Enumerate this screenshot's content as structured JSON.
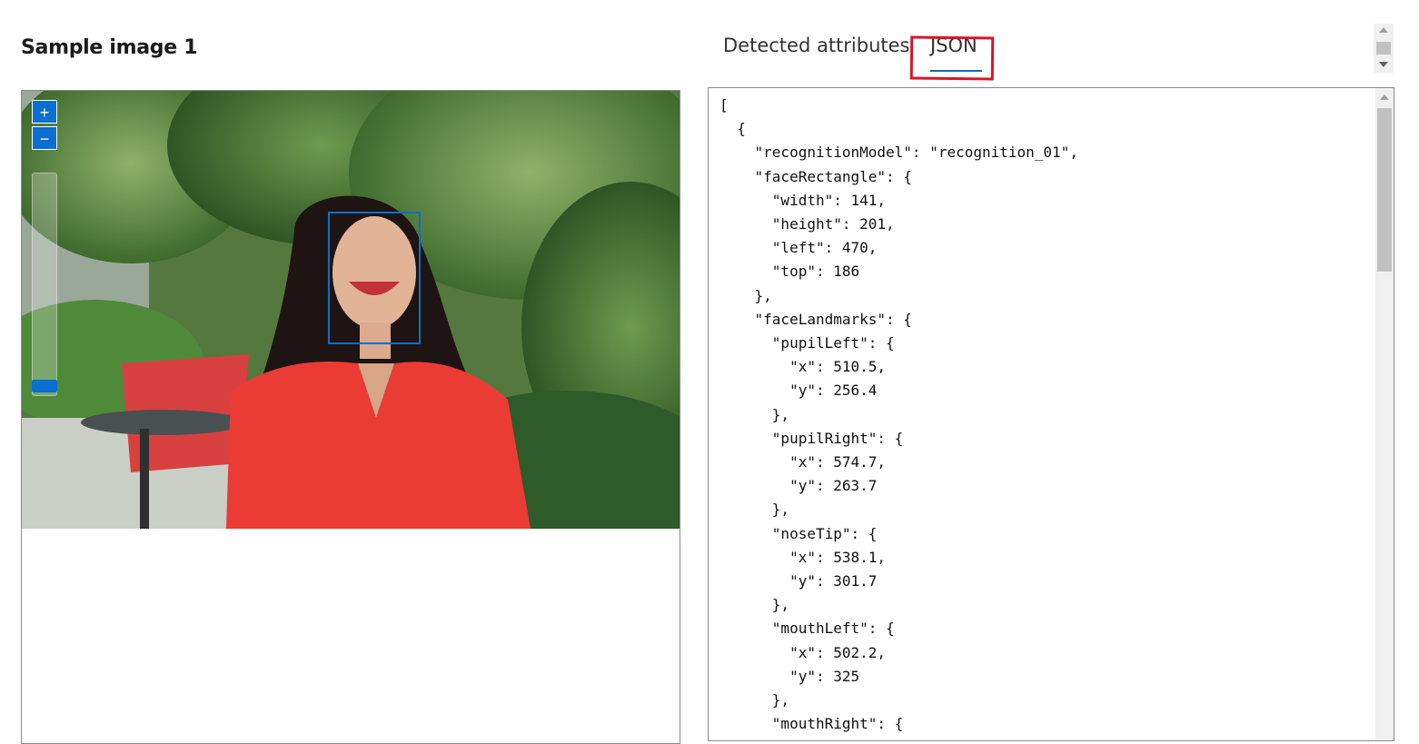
{
  "sample": {
    "title": "Sample image 1"
  },
  "tabs": {
    "attributes": "Detected attributes",
    "json": "JSON"
  },
  "zoom": {
    "in": "+",
    "out": "−"
  },
  "json_output": "[\n  {\n    \"recognitionModel\": \"recognition_01\",\n    \"faceRectangle\": {\n      \"width\": 141,\n      \"height\": 201,\n      \"left\": 470,\n      \"top\": 186\n    },\n    \"faceLandmarks\": {\n      \"pupilLeft\": {\n        \"x\": 510.5,\n        \"y\": 256.4\n      },\n      \"pupilRight\": {\n        \"x\": 574.7,\n        \"y\": 263.7\n      },\n      \"noseTip\": {\n        \"x\": 538.1,\n        \"y\": 301.7\n      },\n      \"mouthLeft\": {\n        \"x\": 502.2,\n        \"y\": 325\n      },\n      \"mouthRight\": {",
  "colors": {
    "accent": "#0f6cbd",
    "highlight": "#d9142c",
    "face_box": "#0a6fd0"
  }
}
